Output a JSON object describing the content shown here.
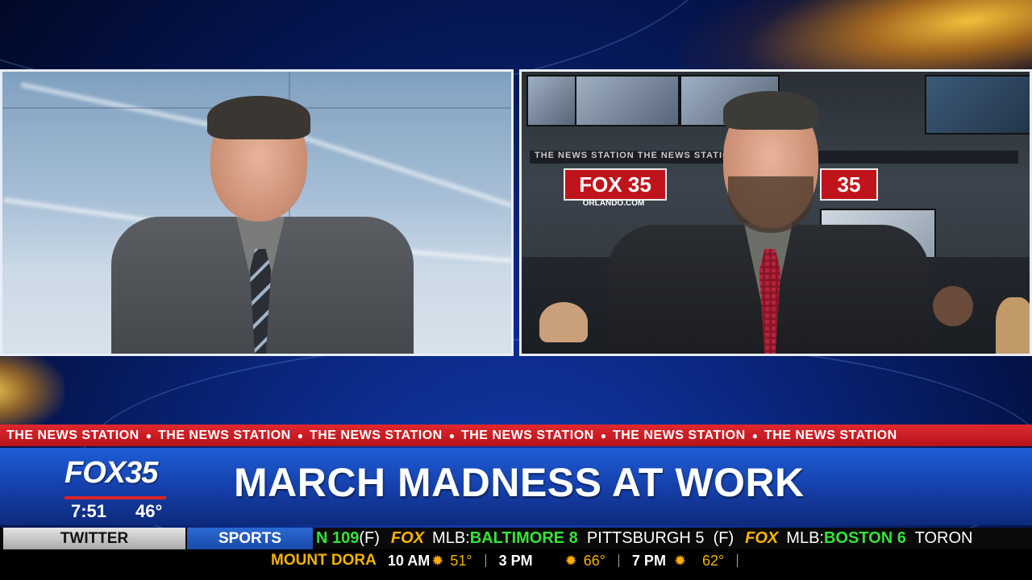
{
  "colors": {
    "fox_red": "#c0141c",
    "score_green": "#36e23c",
    "weather_gold": "#f2b400",
    "lower_third_blue": "#1640ac"
  },
  "left_panel": {
    "description_icon": "anchor-person"
  },
  "right_panel": {
    "sign_left": "FOX 35",
    "sign_left_sub": "ORLANDO.COM",
    "sign_right": "35",
    "wall_text": "THE NEWS STATION   THE NEWS STATION"
  },
  "ticker": {
    "phrase": "THE NEWS STATION",
    "repeat": [
      "THE NEWS STATION",
      "THE NEWS STATION",
      "THE NEWS STATION",
      "THE NEWS STATION",
      "THE NEWS STATION",
      "THE NEWS STATION"
    ]
  },
  "lower_third": {
    "headline": "MARCH MADNESS AT WORK",
    "logo": "FOX35",
    "time": "7:51",
    "temperature": "46°"
  },
  "sports_bar": {
    "tab_twitter": "TWITTER",
    "tab_sports": "SPORTS",
    "segments": [
      {
        "text": "N 109",
        "cls": "sc-green"
      },
      {
        "text": " (F)",
        "cls": "sc-white"
      },
      {
        "text": "FOX",
        "cls": "sc-fox"
      },
      {
        "text": "MLB: ",
        "cls": "sc-white"
      },
      {
        "text": "BALTIMORE 8",
        "cls": "sc-green"
      },
      {
        "text": "  PITTSBURGH 5  (F)",
        "cls": "sc-white"
      },
      {
        "text": "FOX",
        "cls": "sc-fox"
      },
      {
        "text": "MLB: ",
        "cls": "sc-white"
      },
      {
        "text": "BOSTON 6",
        "cls": "sc-green"
      },
      {
        "text": "  TORON",
        "cls": "sc-white"
      }
    ]
  },
  "weather_bar": {
    "city": "MOUNT DORA",
    "slots": [
      {
        "time": "10 AM",
        "temp": "51°"
      },
      {
        "time": "3 PM",
        "temp": "66°"
      },
      {
        "time": "7 PM",
        "temp": "62°"
      }
    ],
    "sun_icon": "sun-icon"
  }
}
